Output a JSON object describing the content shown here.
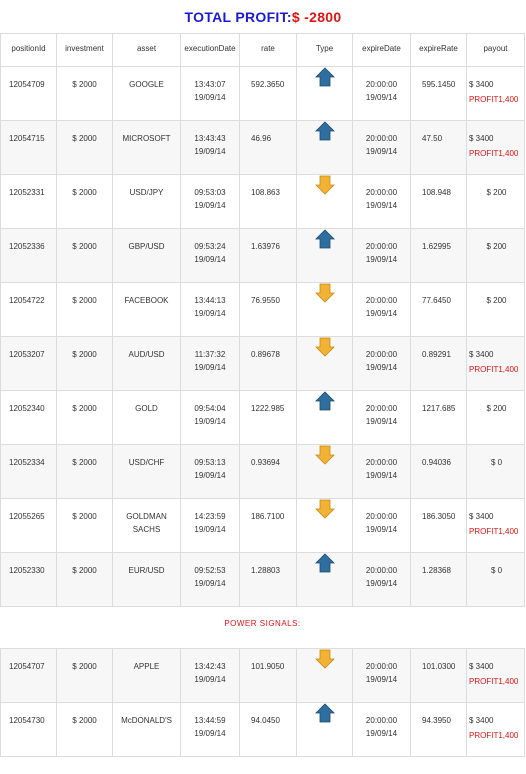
{
  "header": {
    "label": "TOTAL PROFIT:",
    "currency": "$",
    "amount": " -2800"
  },
  "colors": {
    "title": "#1a1ad6",
    "profit_red": "#e01414",
    "arrow_up": "#2f6f9f",
    "arrow_down": "#f2b234"
  },
  "columns": [
    "positionId",
    "investment",
    "asset",
    "executionDate",
    "rate",
    "Type",
    "expireDate",
    "expireRate",
    "payout"
  ],
  "rows": [
    {
      "positionId": "12054709",
      "investment": "$ 2000",
      "asset": "GOOGLE",
      "execTime": "13:43:07",
      "execDate": "19/09/14",
      "rate": "592.3650",
      "type": "up",
      "expTime": "20:00:00",
      "expDate": "19/09/14",
      "expireRate": "595.1450",
      "payout": "$ 3400",
      "profit": "PROFIT1,400"
    },
    {
      "positionId": "12054715",
      "investment": "$ 2000",
      "asset": "MICROSOFT",
      "execTime": "13:43:43",
      "execDate": "19/09/14",
      "rate": "46.96",
      "type": "up",
      "expTime": "20:00:00",
      "expDate": "19/09/14",
      "expireRate": "47.50",
      "payout": "$ 3400",
      "profit": "PROFIT1,400"
    },
    {
      "positionId": "12052331",
      "investment": "$ 2000",
      "asset": "USD/JPY",
      "execTime": "09:53:03",
      "execDate": "19/09/14",
      "rate": "108.863",
      "type": "down",
      "expTime": "20:00:00",
      "expDate": "19/09/14",
      "expireRate": "108.948",
      "payout": "$ 200",
      "profit": ""
    },
    {
      "positionId": "12052336",
      "investment": "$ 2000",
      "asset": "GBP/USD",
      "execTime": "09:53:24",
      "execDate": "19/09/14",
      "rate": "1.63976",
      "type": "up",
      "expTime": "20:00:00",
      "expDate": "19/09/14",
      "expireRate": "1.62995",
      "payout": "$ 200",
      "profit": ""
    },
    {
      "positionId": "12054722",
      "investment": "$ 2000",
      "asset": "FACEBOOK",
      "execTime": "13:44:13",
      "execDate": "19/09/14",
      "rate": "76.9550",
      "type": "down",
      "expTime": "20:00:00",
      "expDate": "19/09/14",
      "expireRate": "77.6450",
      "payout": "$ 200",
      "profit": ""
    },
    {
      "positionId": "12053207",
      "investment": "$ 2000",
      "asset": "AUD/USD",
      "execTime": "11:37:32",
      "execDate": "19/09/14",
      "rate": "0.89678",
      "type": "down",
      "expTime": "20:00:00",
      "expDate": "19/09/14",
      "expireRate": "0.89291",
      "payout": "$ 3400",
      "profit": "PROFIT1,400"
    },
    {
      "positionId": "12052340",
      "investment": "$ 2000",
      "asset": "GOLD",
      "execTime": "09:54:04",
      "execDate": "19/09/14",
      "rate": "1222.985",
      "type": "up",
      "expTime": "20:00:00",
      "expDate": "19/09/14",
      "expireRate": "1217.685",
      "payout": "$ 200",
      "profit": ""
    },
    {
      "positionId": "12052334",
      "investment": "$ 2000",
      "asset": "USD/CHF",
      "execTime": "09:53:13",
      "execDate": "19/09/14",
      "rate": "0.93694",
      "type": "down",
      "expTime": "20:00:00",
      "expDate": "19/09/14",
      "expireRate": "0.94036",
      "payout": "$ 0",
      "profit": ""
    },
    {
      "positionId": "12055265",
      "investment": "$ 2000",
      "asset": "GOLDMAN SACHS",
      "execTime": "14:23:59",
      "execDate": "19/09/14",
      "rate": "186.7100",
      "type": "down",
      "expTime": "20:00:00",
      "expDate": "19/09/14",
      "expireRate": "186.3050",
      "payout": "$ 3400",
      "profit": "PROFIT1,400"
    },
    {
      "positionId": "12052330",
      "investment": "$ 2000",
      "asset": "EUR/USD",
      "execTime": "09:52:53",
      "execDate": "19/09/14",
      "rate": "1.28803",
      "type": "up",
      "expTime": "20:00:00",
      "expDate": "19/09/14",
      "expireRate": "1.28368",
      "payout": "$ 0",
      "profit": ""
    }
  ],
  "signals_label": "POWER SIGNALS:",
  "signal_rows": [
    {
      "positionId": "12054707",
      "investment": "$ 2000",
      "asset": "APPLE",
      "execTime": "13:42:43",
      "execDate": "19/09/14",
      "rate": "101.9050",
      "type": "down",
      "expTime": "20:00:00",
      "expDate": "19/09/14",
      "expireRate": "101.0300",
      "payout": "$ 3400",
      "profit": "PROFIT1,400"
    },
    {
      "positionId": "12054730",
      "investment": "$ 2000",
      "asset": "McDONALD'S",
      "execTime": "13:44:59",
      "execDate": "19/09/14",
      "rate": "94.0450",
      "type": "up",
      "expTime": "20:00:00",
      "expDate": "19/09/14",
      "expireRate": "94.3950",
      "payout": "$ 3400",
      "profit": "PROFIT1,400"
    }
  ]
}
